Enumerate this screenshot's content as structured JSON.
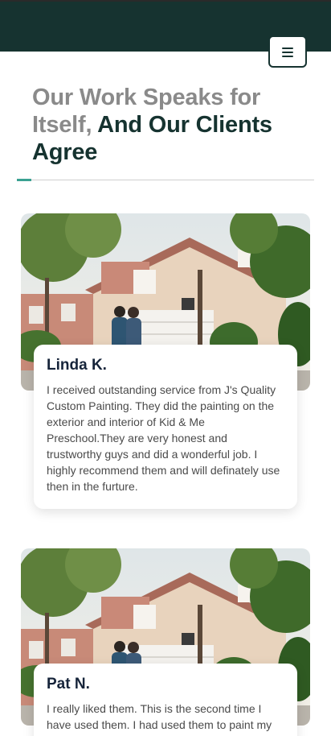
{
  "header": {
    "menu_icon": "hamburger-icon",
    "bg_color": "#163330"
  },
  "section": {
    "heading_light": "Our Work Speaks for Itself,",
    "heading_bold": "And Our Clients Agree",
    "accent_color": "#3aa192"
  },
  "testimonials": [
    {
      "name": "Linda K.",
      "text": "I received outstanding service from J's Quality Custom Painting. They did the painting on the exterior and interior of Kid & Me Preschool.They are very honest and trustworthy guys and did a wonderful job. I highly recommend them and will definately use then in the furture."
    },
    {
      "name": "Pat N.",
      "text": "I really liked them. This is the second time I have used them. I had used them to paint my"
    }
  ]
}
